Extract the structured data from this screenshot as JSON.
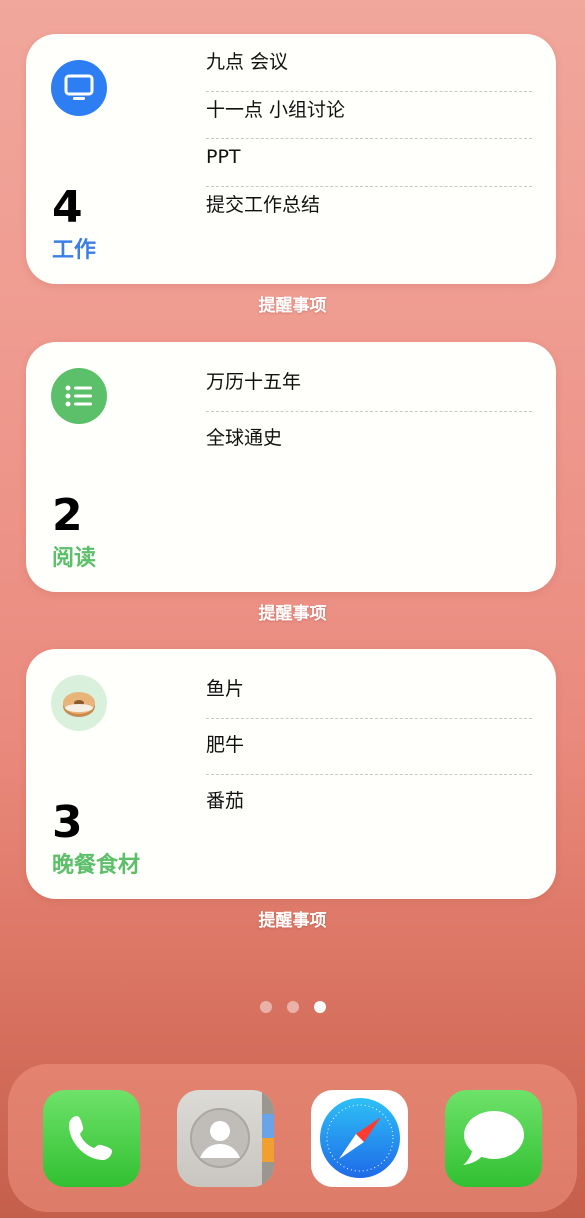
{
  "widgets": [
    {
      "count": "4",
      "name": "工作",
      "name_color": "#3a7ee6",
      "icon": "monitor-icon",
      "icon_bg": "#2d7ef2",
      "items": [
        "九点 会议",
        "十一点 小组讨论",
        "PPT",
        "提交工作总结"
      ],
      "label": "提醒事项"
    },
    {
      "count": "2",
      "name": "阅读",
      "name_color": "#5cbf6a",
      "icon": "list-icon",
      "icon_bg": "#5cbf6a",
      "items": [
        "万历十五年",
        "全球通史"
      ],
      "label": "提醒事项"
    },
    {
      "count": "3",
      "name": "晚餐食材",
      "name_color": "#5cbf6a",
      "icon": "bagel-icon",
      "icon_bg": "#d8f0dc",
      "items": [
        "鱼片",
        "肥牛",
        "番茄"
      ],
      "label": "提醒事项"
    }
  ],
  "page_dots": {
    "total": 3,
    "active_index": 2
  },
  "dock": {
    "apps": [
      {
        "name": "Phone",
        "icon": "phone-icon"
      },
      {
        "name": "Contacts",
        "icon": "contacts-icon"
      },
      {
        "name": "Safari",
        "icon": "safari-compass-icon"
      },
      {
        "name": "Messages",
        "icon": "messages-bubble-icon"
      }
    ]
  }
}
